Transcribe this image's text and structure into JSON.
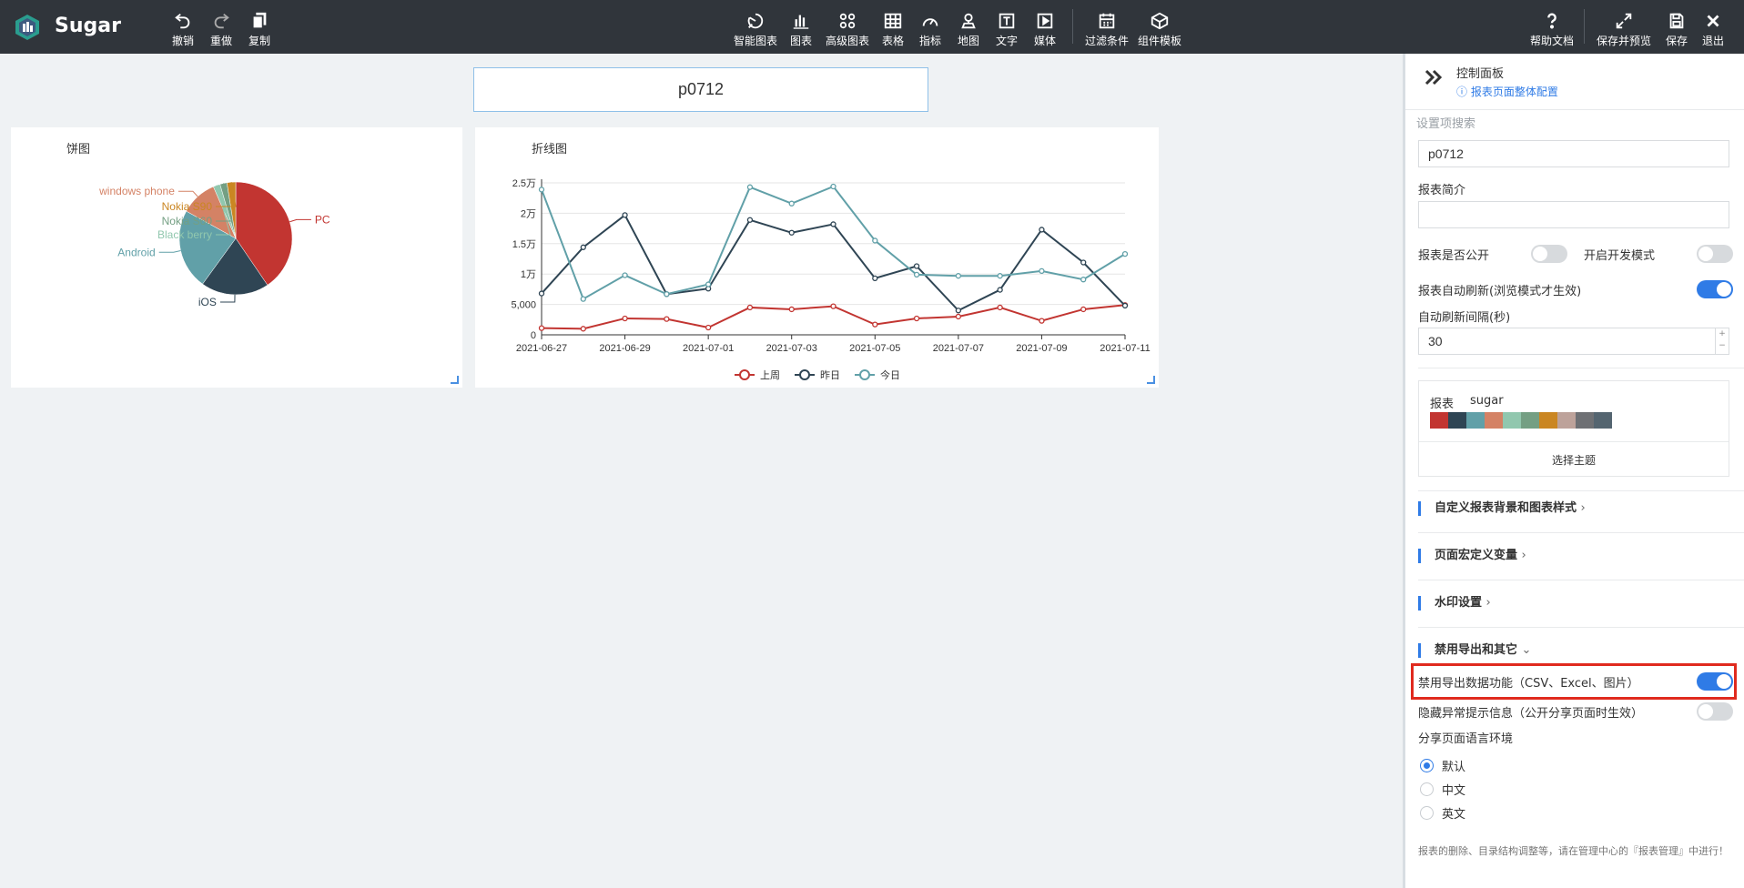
{
  "app": {
    "name": "Sugar"
  },
  "toolbar": {
    "undo": "撤销",
    "redo": "重做",
    "copy": "复制",
    "smart_chart": "智能图表",
    "chart": "图表",
    "advanced_chart": "高级图表",
    "table": "表格",
    "metric": "指标",
    "map": "地图",
    "text": "文字",
    "media": "媒体",
    "filter": "过滤条件",
    "component_template": "组件模板",
    "help": "帮助文档",
    "save_preview": "保存并预览",
    "save": "保存",
    "exit": "退出"
  },
  "report": {
    "title": "p0712"
  },
  "pie_chart": {
    "title": "饼图",
    "chart_data": {
      "type": "pie",
      "slices": [
        {
          "label": "PC",
          "value": 40.5,
          "color": "#c23531"
        },
        {
          "label": "iOS",
          "value": 19.5,
          "color": "#2f4554"
        },
        {
          "label": "Android",
          "value": 23,
          "color": "#61a0a8"
        },
        {
          "label": "windows phone",
          "value": 10.5,
          "color": "#d48265"
        },
        {
          "label": "Black berry",
          "value": 2,
          "color": "#91c7ae"
        },
        {
          "label": "Nokia S60",
          "value": 2,
          "color": "#749f83"
        },
        {
          "label": "Nokia S90",
          "value": 2.5,
          "color": "#ca8622"
        }
      ]
    }
  },
  "line_chart": {
    "title": "折线图",
    "chart_data": {
      "type": "line",
      "x": [
        "2021-06-27",
        "2021-06-28",
        "2021-06-29",
        "2021-06-30",
        "2021-07-01",
        "2021-07-02",
        "2021-07-03",
        "2021-07-04",
        "2021-07-05",
        "2021-07-06",
        "2021-07-07",
        "2021-07-08",
        "2021-07-09",
        "2021-07-10",
        "2021-07-11"
      ],
      "x_tick_labels": [
        "2021-06-27",
        "2021-06-29",
        "2021-07-01",
        "2021-07-03",
        "2021-07-05",
        "2021-07-07",
        "2021-07-09",
        "2021-07-11"
      ],
      "y_ticks": [
        0,
        5000,
        10000,
        15000,
        20000,
        25000
      ],
      "y_tick_labels": [
        "0",
        "5,000",
        "1万",
        "1.5万",
        "2万",
        "2.5万"
      ],
      "ylim": [
        0,
        25000
      ],
      "grid": true,
      "legend_position": "bottom-center",
      "series": [
        {
          "name": "上周",
          "color": "#c23531",
          "values": [
            1100,
            1000,
            2700,
            2600,
            1200,
            4500,
            4200,
            4700,
            1700,
            2700,
            3000,
            4500,
            2300,
            4200,
            4900
          ]
        },
        {
          "name": "昨日",
          "color": "#2f4554",
          "values": [
            6800,
            14400,
            19700,
            6700,
            7600,
            18900,
            16800,
            18200,
            9300,
            11300,
            4000,
            7400,
            17300,
            11900,
            4800
          ]
        },
        {
          "name": "今日",
          "color": "#61a0a8",
          "values": [
            23900,
            5900,
            9800,
            6700,
            8300,
            24300,
            21600,
            24400,
            15500,
            9900,
            9700,
            9700,
            10500,
            9100,
            13300
          ]
        }
      ]
    }
  },
  "panel": {
    "title": "控制面板",
    "config_link": "报表页面整体配置",
    "search_placeholder": "设置项搜索",
    "name_value": "p0712",
    "intro_label": "报表简介",
    "intro_value": "",
    "public_label": "报表是否公开",
    "public_on": false,
    "dev_label": "开启开发模式",
    "dev_on": false,
    "autorefresh_label": "报表自动刷新(浏览模式才生效)",
    "autorefresh_on": true,
    "interval_label": "自动刷新间隔(秒)",
    "interval_value": "30",
    "theme_prefix": "报表",
    "theme_name": "sugar",
    "theme_colors": [
      "#c23531",
      "#2f4554",
      "#61a0a8",
      "#d48265",
      "#91c7ae",
      "#749f83",
      "#ca8622",
      "#bda29a",
      "#6e7074",
      "#546570"
    ],
    "choose_theme": "选择主题",
    "sections": {
      "style": "自定义报表背景和图表样式",
      "macro": "页面宏定义变量",
      "watermark": "水印设置",
      "export": "禁用导出和其它"
    },
    "disable_export_label": "禁用导出数据功能（CSV、Excel、图片）",
    "disable_export_on": true,
    "hide_error_label": "隐藏异常提示信息（公开分享页面时生效）",
    "hide_error_on": false,
    "lang_label": "分享页面语言环境",
    "lang_options": [
      "默认",
      "中文",
      "英文"
    ],
    "lang_selected": "默认",
    "footer_note": "报表的删除、目录结构调整等，请在管理中心的『报表管理』中进行！"
  }
}
